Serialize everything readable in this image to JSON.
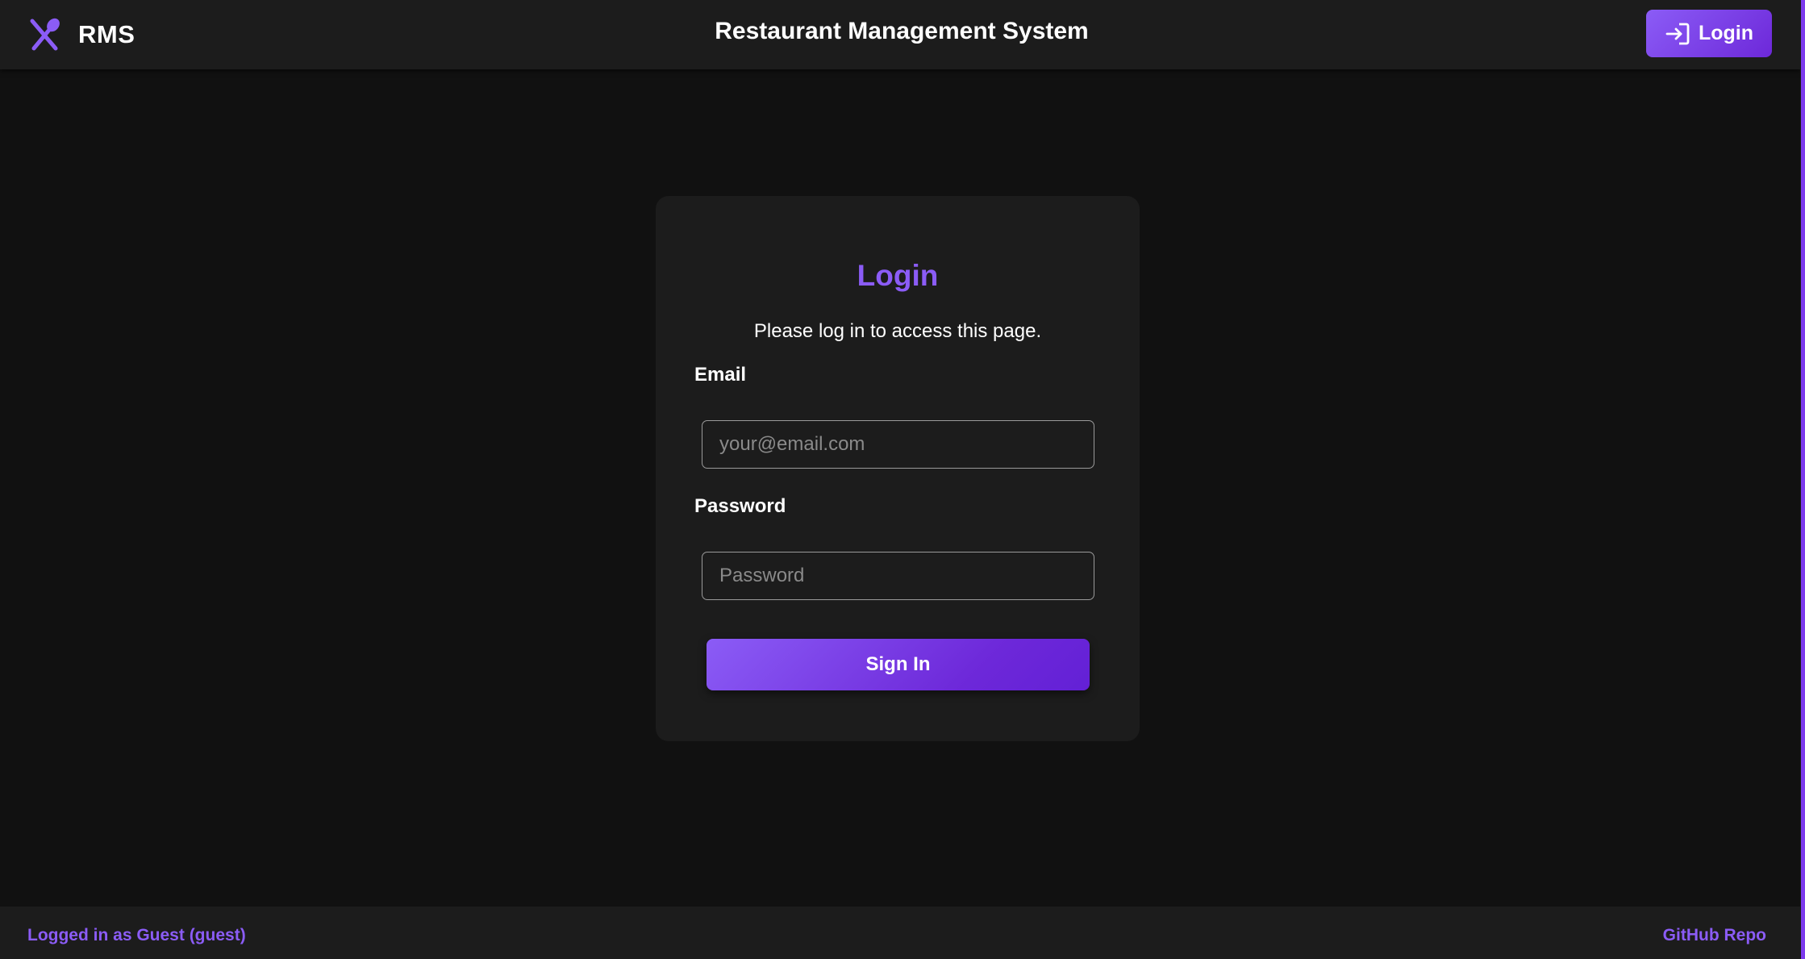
{
  "header": {
    "brand_name": "RMS",
    "brand_icon": "utensils-icon",
    "title": "Restaurant Management System",
    "login_label": "Login",
    "login_icon": "login-arrow-icon"
  },
  "login_card": {
    "title": "Login",
    "subtitle": "Please log in to access this page.",
    "email_label": "Email",
    "email_value": "",
    "email_placeholder": "your@email.com",
    "password_label": "Password",
    "password_value": "",
    "password_placeholder": "Password",
    "submit_label": "Sign In"
  },
  "footer": {
    "status_text": "Logged in as Guest (guest)",
    "repo_link": "GitHub Repo"
  },
  "colors": {
    "accent": "#8b5cf6",
    "accent_dark": "#6d28d9",
    "background": "#111111",
    "surface": "#1c1c1c"
  }
}
